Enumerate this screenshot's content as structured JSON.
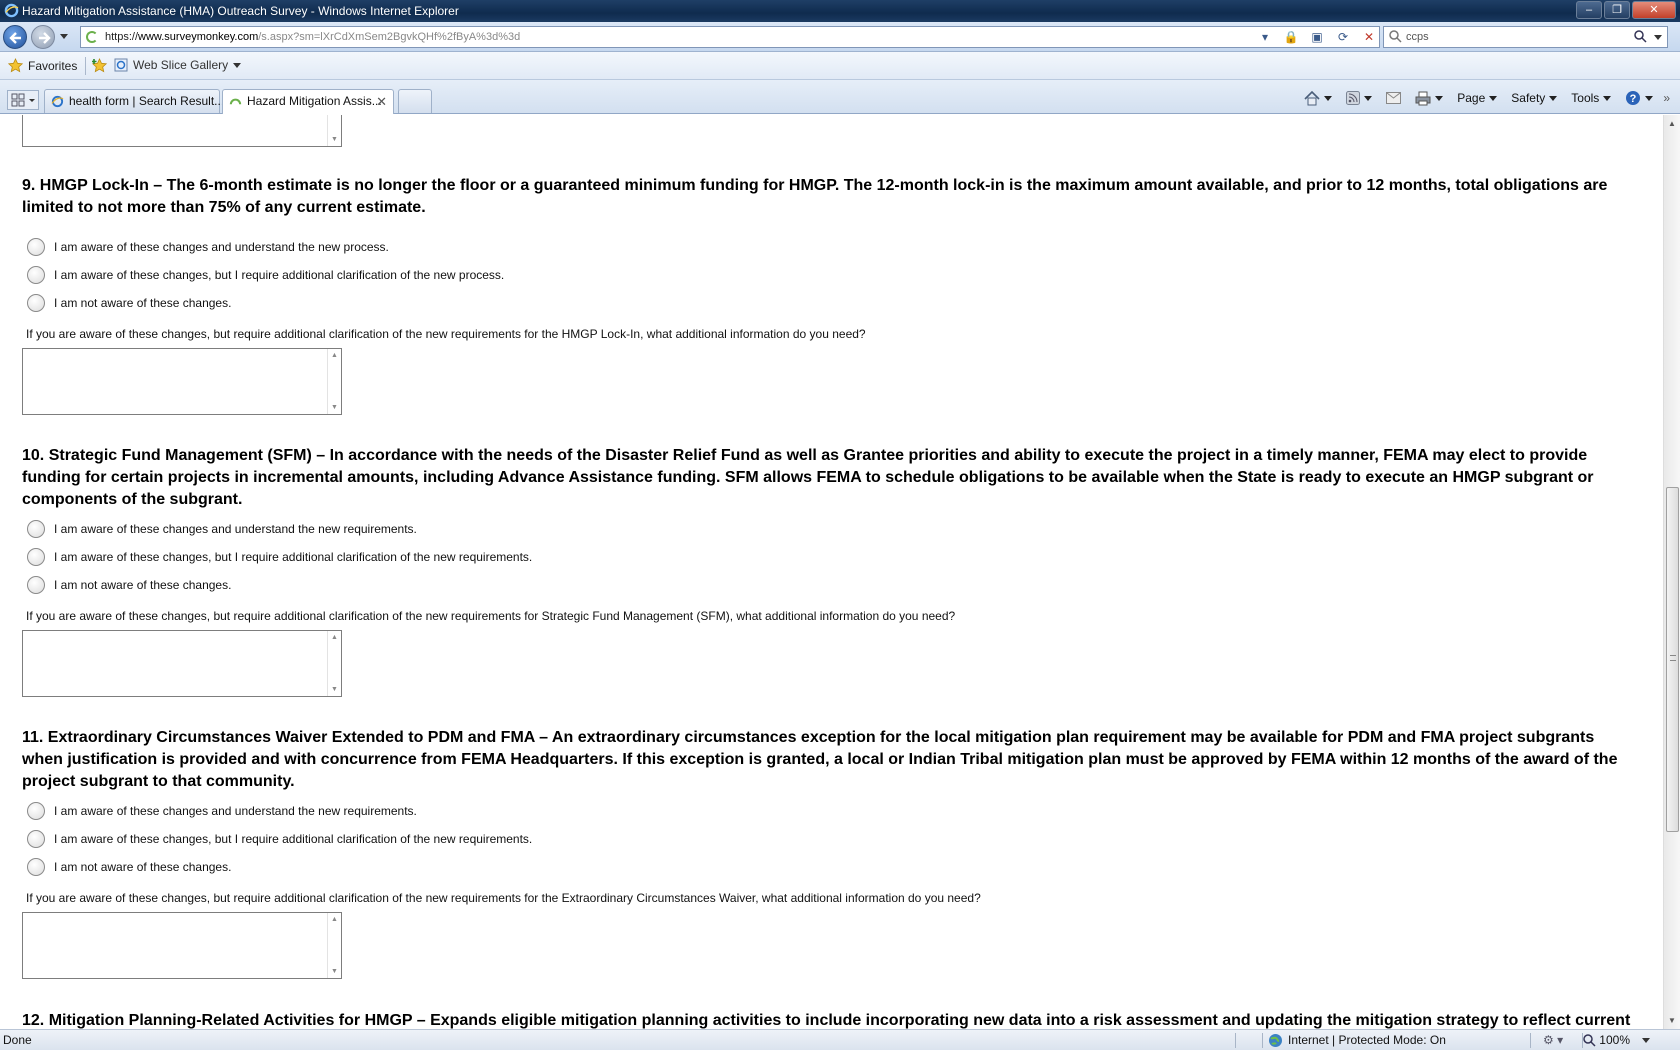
{
  "window": {
    "title": "Hazard Mitigation Assistance (HMA) Outreach Survey - Windows Internet Explorer",
    "minimize": "–",
    "maximize": "❐",
    "close": "✕"
  },
  "address": {
    "scheme": "https://",
    "host": "www.surveymonkey.com",
    "path": "/s.aspx?sm=lXrCdXmSem2BgvkQHf%2fByA%3d%3d"
  },
  "search": {
    "value": "ccps"
  },
  "favorites": {
    "favorites_label": "Favorites",
    "web_slice_label": "Web Slice Gallery"
  },
  "tabs": [
    {
      "label": "health form | Search Result..."
    },
    {
      "label": "Hazard Mitigation Assis..."
    }
  ],
  "commands": {
    "page": "Page",
    "safety": "Safety",
    "tools": "Tools"
  },
  "survey": {
    "q9": {
      "text": "9. HMGP Lock-In – The 6-month estimate is no longer the floor or a guaranteed minimum funding for HMGP. The 12-month lock-in is the maximum amount available, and prior to 12 months, total obligations are limited to not more than 75% of any current estimate.",
      "choices": [
        "I am aware of these changes and understand the new process.",
        "I am aware of these changes, but I require additional clarification of the new process.",
        "I am not aware of these changes."
      ],
      "prompt": "If you are aware of these changes, but require additional clarification of the new requirements for the HMGP Lock-In, what additional information do you need?"
    },
    "q10": {
      "text": "10. Strategic Fund Management (SFM) – In accordance with the needs of the Disaster Relief Fund as well as Grantee priorities and ability to execute the project in a timely manner, FEMA may elect to provide funding for certain projects in incremental amounts, including Advance Assistance funding. SFM allows FEMA to schedule obligations to be available when the State is ready to execute an HMGP subgrant or components of the subgrant.",
      "choices": [
        "I am aware of these changes and understand the new requirements.",
        "I am aware of these changes, but I require additional clarification of the new requirements.",
        "I am not aware of these changes."
      ],
      "prompt": "If you are aware of these changes, but require additional clarification of the new requirements for Strategic Fund Management (SFM), what additional information do you need?"
    },
    "q11": {
      "text": "11. Extraordinary Circumstances Waiver Extended to PDM and FMA – An extraordinary circumstances exception for the local mitigation plan requirement may be available for PDM and FMA project subgrants when justification is provided and with concurrence from FEMA Headquarters. If this exception is granted, a local or Indian Tribal mitigation plan must be approved by FEMA within 12 months of the award of the project subgrant to that community.",
      "choices": [
        "I am aware of these changes and understand the new requirements.",
        "I am aware of these changes, but I require additional clarification of the new requirements.",
        "I am not aware of these changes."
      ],
      "prompt": "If you are aware of these changes, but require additional clarification of the new requirements for the Extraordinary Circumstances Waiver, what additional information do you need?"
    },
    "q12": {
      "text": "12. Mitigation Planning-Related Activities for HMGP – Expands eligible mitigation planning activities to include incorporating new data into a risk assessment and updating the mitigation strategy to reflect current"
    }
  },
  "status": {
    "left": "Done",
    "zone": "Internet | Protected Mode: On",
    "zoom": "100%"
  }
}
